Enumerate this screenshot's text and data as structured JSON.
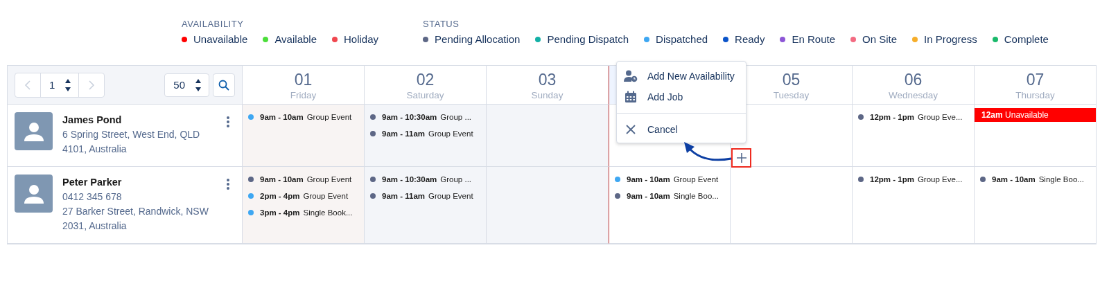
{
  "legend": [
    {
      "title": "AVAILABILITY",
      "items": [
        {
          "label": "Unavailable",
          "color": "#ff0000"
        },
        {
          "label": "Available",
          "color": "#4bde3a"
        },
        {
          "label": "Holiday",
          "color": "#f0474f"
        }
      ]
    },
    {
      "title": "STATUS",
      "items": [
        {
          "label": "Pending Allocation",
          "color": "#5d6786"
        },
        {
          "label": "Pending Dispatch",
          "color": "#13b0a6"
        },
        {
          "label": "Dispatched",
          "color": "#3ea7f2"
        },
        {
          "label": "Ready",
          "color": "#0b54c9"
        },
        {
          "label": "En Route",
          "color": "#8d56d6"
        },
        {
          "label": "On Site",
          "color": "#f36b82"
        },
        {
          "label": "In Progress",
          "color": "#f6ae2b"
        },
        {
          "label": "Complete",
          "color": "#1ab96b"
        }
      ]
    }
  ],
  "pager": {
    "page": "1",
    "page_size": "50"
  },
  "days": [
    {
      "number": "01",
      "weekday": "Friday",
      "kind": "holiday"
    },
    {
      "number": "02",
      "weekday": "Saturday",
      "kind": "weekend"
    },
    {
      "number": "03",
      "weekday": "Sunday",
      "kind": "weekend"
    },
    {
      "kind": "today"
    },
    {
      "number": "05",
      "weekday": "Tuesday",
      "kind": "normal"
    },
    {
      "number": "06",
      "weekday": "Wednesday",
      "kind": "normal"
    },
    {
      "number": "07",
      "weekday": "Thursday",
      "kind": "normal"
    }
  ],
  "resources": [
    {
      "name": "James Pond",
      "details": [
        "6 Spring Street, West End, QLD 4101, Australia"
      ],
      "cells": [
        [
          {
            "kind": "job",
            "time": "9am - 10am",
            "title": "Group Event",
            "color": "#3ea7f2"
          }
        ],
        [
          {
            "kind": "job",
            "time": "9am - 10:30am",
            "title": "Group ...",
            "color": "#5d6786"
          },
          {
            "kind": "job",
            "time": "9am - 11am",
            "title": "Group Event",
            "color": "#5d6786"
          }
        ],
        [],
        [],
        [],
        [
          {
            "kind": "job",
            "time": "12pm - 1pm",
            "title": "Group Eve...",
            "color": "#5d6786"
          }
        ],
        [
          {
            "kind": "unavailable",
            "time": "12am",
            "title": "Unavailable",
            "color": "#ff0000"
          }
        ]
      ]
    },
    {
      "name": "Peter Parker",
      "details": [
        "0412 345 678",
        "27 Barker Street, Randwick, NSW 2031, Australia"
      ],
      "cells": [
        [
          {
            "kind": "job",
            "time": "9am - 10am",
            "title": "Group Event",
            "color": "#5d6786"
          },
          {
            "kind": "job",
            "time": "2pm - 4pm",
            "title": "Group Event",
            "color": "#3ea7f2"
          },
          {
            "kind": "job",
            "time": "3pm - 4pm",
            "title": "Single Book...",
            "color": "#3ea7f2"
          }
        ],
        [
          {
            "kind": "job",
            "time": "9am - 10:30am",
            "title": "Group ...",
            "color": "#5d6786"
          },
          {
            "kind": "job",
            "time": "9am - 11am",
            "title": "Group Event",
            "color": "#5d6786"
          }
        ],
        [],
        [
          {
            "kind": "job",
            "time": "9am - 10am",
            "title": "Group Event",
            "color": "#3ea7f2"
          },
          {
            "kind": "job",
            "time": "9am - 10am",
            "title": "Single Boo...",
            "color": "#5d6786"
          }
        ],
        [],
        [
          {
            "kind": "job",
            "time": "12pm - 1pm",
            "title": "Group Eve...",
            "color": "#5d6786"
          }
        ],
        [
          {
            "kind": "job",
            "time": "9am - 10am",
            "title": "Single Boo...",
            "color": "#5d6786"
          }
        ]
      ]
    }
  ],
  "context_menu": {
    "groups": [
      [
        {
          "label": "Add New Availability"
        },
        {
          "label": "Add Job"
        }
      ],
      [
        {
          "label": "Cancel"
        }
      ]
    ]
  }
}
